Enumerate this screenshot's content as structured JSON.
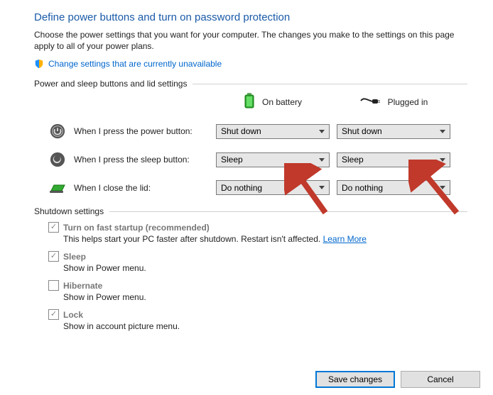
{
  "title": "Define power buttons and turn on password protection",
  "description": "Choose the power settings that you want for your computer. The changes you make to the settings on this page apply to all of your power plans.",
  "admin_link": "Change settings that are currently unavailable",
  "section1_label": "Power and sleep buttons and lid settings",
  "columns": {
    "battery": "On battery",
    "plugged": "Plugged in"
  },
  "rows": {
    "power": {
      "label": "When I press the power button:",
      "battery_value": "Shut down",
      "plugged_value": "Shut down"
    },
    "sleep": {
      "label": "When I press the sleep button:",
      "battery_value": "Sleep",
      "plugged_value": "Sleep"
    },
    "lid": {
      "label": "When I close the lid:",
      "battery_value": "Do nothing",
      "plugged_value": "Do nothing"
    }
  },
  "section2_label": "Shutdown settings",
  "shutdown": {
    "fast": {
      "label": "Turn on fast startup (recommended)",
      "sub": "This helps start your PC faster after shutdown. Restart isn't affected. ",
      "learn": "Learn More"
    },
    "sleep": {
      "label": "Sleep",
      "sub": "Show in Power menu."
    },
    "hibernate": {
      "label": "Hibernate",
      "sub": "Show in Power menu."
    },
    "lock": {
      "label": "Lock",
      "sub": "Show in account picture menu."
    }
  },
  "buttons": {
    "save": "Save changes",
    "cancel": "Cancel"
  }
}
